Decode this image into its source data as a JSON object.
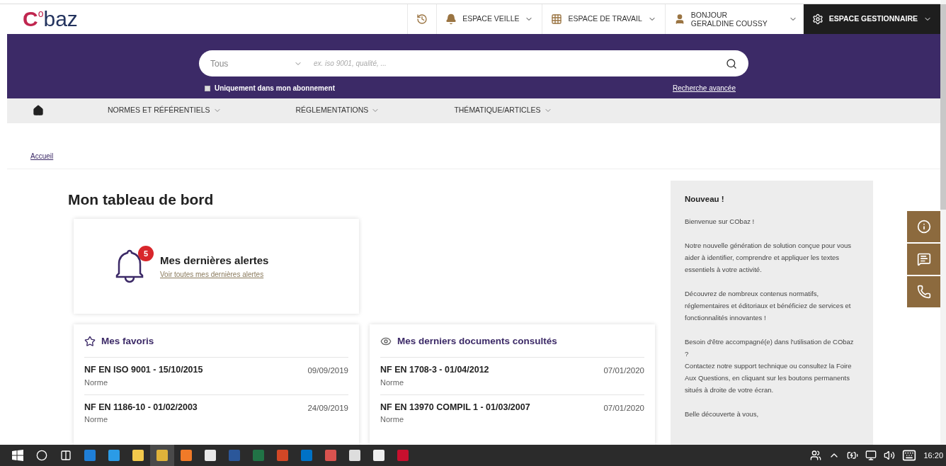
{
  "logo": {
    "first": "C",
    "mark": "o",
    "rest": "baz"
  },
  "header_items": [
    {
      "kind": "history"
    },
    {
      "kind": "watch",
      "label": "ESPACE VEILLE"
    },
    {
      "kind": "work",
      "label": "ESPACE DE TRAVAIL"
    },
    {
      "kind": "user",
      "label": "BONJOUR",
      "sublabel": "GERALDINE COUSSY"
    },
    {
      "kind": "admin",
      "label": "ESPACE GESTIONNAIRE"
    }
  ],
  "search": {
    "scope": "Tous",
    "placeholder": "ex. iso 9001, qualité, ...",
    "subscription_only": {
      "label": "Uniquement dans mon abonnement",
      "checked": false
    },
    "advanced_link": "Recherche avancée"
  },
  "nav": [
    "NORMES ET RÉFÉRENTIELS",
    "RÉGLEMENTATIONS",
    "THÉMATIQUE/ARTICLES"
  ],
  "breadcrumb": "Accueil",
  "title": "Mon tableau de bord",
  "alerts": {
    "count": "5",
    "title": "Mes dernières alertes",
    "link": "Voir toutes mes dernières alertes"
  },
  "favorites": {
    "title": "Mes favoris",
    "rows": [
      {
        "name": "NF EN ISO 9001 - 15/10/2015",
        "type": "Norme",
        "date": "09/09/2019"
      },
      {
        "name": "NF EN 1186-10 - 01/02/2003",
        "type": "Norme",
        "date": "24/09/2019"
      }
    ]
  },
  "recent": {
    "title": "Mes derniers documents consultés",
    "rows": [
      {
        "name": "NF EN 1708-3 - 01/04/2012",
        "type": "Norme",
        "date": "07/01/2020"
      },
      {
        "name": "NF EN 13970 COMPIL 1 - 01/03/2007",
        "type": "Norme",
        "date": "07/01/2020"
      }
    ]
  },
  "news": {
    "title": "Nouveau !",
    "paragraphs": [
      [
        "Bienvenue sur CObaz !"
      ],
      [
        "Notre nouvelle génération de solution conçue pour vous aider à identifier, comprendre et appliquer les textes essentiels à votre activité."
      ],
      [
        "Découvrez de nombreux contenus normatifs, réglementaires et éditoriaux et bénéficiez de services et fonctionnalités innovantes !"
      ],
      [
        "Besoin d'être accompagné(e) dans l'utilisation de CObaz ?",
        "Contactez notre support technique ou consultez la Foire Aux Questions, en cliquant sur les boutons permanents situés à droite de votre écran."
      ],
      [
        "Belle découverte à vous,"
      ]
    ]
  },
  "side_buttons": [
    {
      "kind": "info"
    },
    {
      "kind": "message"
    },
    {
      "kind": "phone"
    }
  ],
  "taskbar": {
    "apps": [
      {
        "kind": "start"
      },
      {
        "kind": "search"
      },
      {
        "kind": "tasks"
      },
      {
        "kind": "edge",
        "color": "#1f7fd8"
      },
      {
        "kind": "ie",
        "color": "#2b9be6"
      },
      {
        "kind": "folder",
        "color": "#f2c94c"
      },
      {
        "kind": "chrome",
        "color": "#e0b33a",
        "selected": true
      },
      {
        "kind": "firefox",
        "color": "#f07a28"
      },
      {
        "kind": "store",
        "color": "#e9e9e9"
      },
      {
        "kind": "word",
        "color": "#2b579a"
      },
      {
        "kind": "excel",
        "color": "#217346"
      },
      {
        "kind": "powerpoint",
        "color": "#d24726"
      },
      {
        "kind": "outlook",
        "color": "#0072c6"
      },
      {
        "kind": "snip",
        "color": "#d9534f"
      },
      {
        "kind": "misc",
        "color": "#dddddd"
      },
      {
        "kind": "photo",
        "color": "#eeeeee"
      },
      {
        "kind": "pdf",
        "color": "#c8102e"
      }
    ],
    "time": "16:20"
  }
}
